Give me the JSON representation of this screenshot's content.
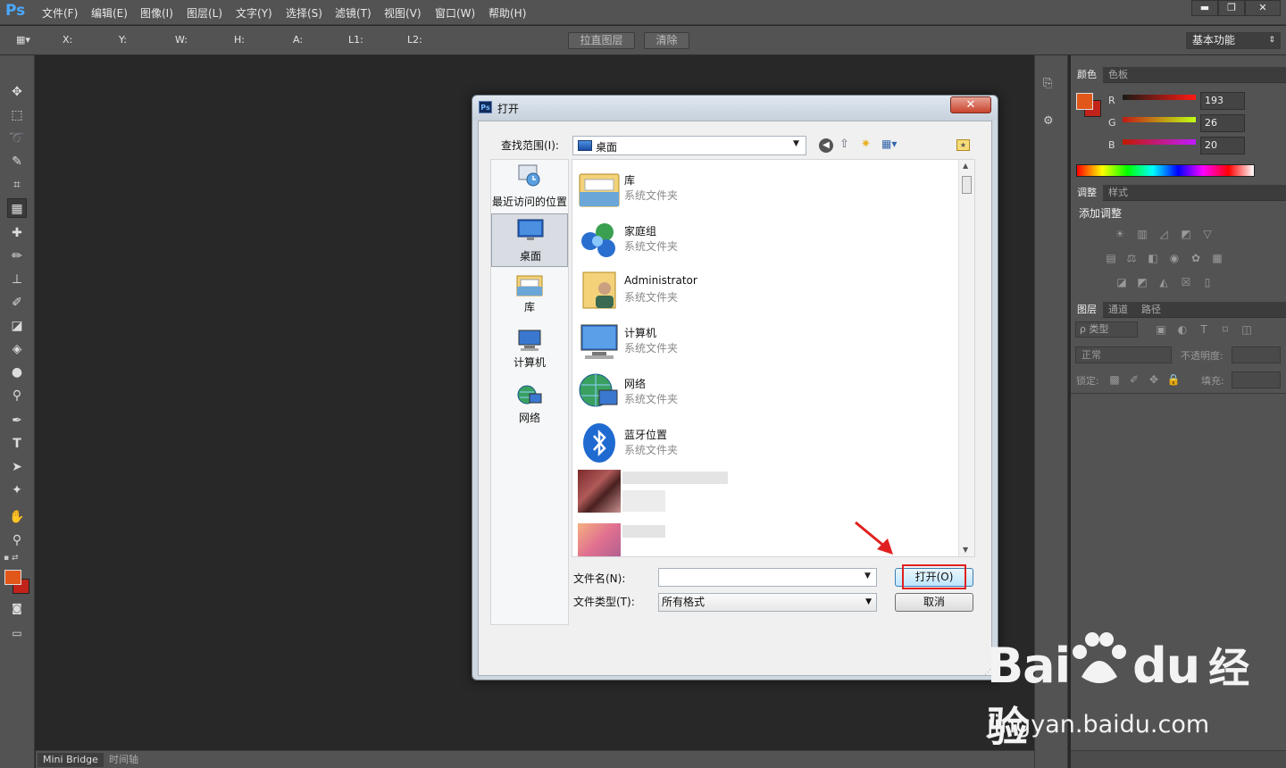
{
  "app": {
    "logo": "Ps",
    "accent": "#4aa8ff"
  },
  "menu": [
    "文件(F)",
    "编辑(E)",
    "图像(I)",
    "图层(L)",
    "文字(Y)",
    "选择(S)",
    "滤镜(T)",
    "视图(V)",
    "窗口(W)",
    "帮助(H)"
  ],
  "window_controls": {
    "minimize": "▬",
    "restore": "❐",
    "close": "✕"
  },
  "options": {
    "labels": [
      "X:",
      "Y:",
      "W:",
      "H:",
      "A:",
      "L1:",
      "L2:"
    ],
    "straighten_button": "拉直图层",
    "clear_button": "清除",
    "workspace": "基本功能"
  },
  "panels": {
    "color": {
      "tabs": [
        "颜色",
        "色板"
      ],
      "r_label": "R",
      "g_label": "G",
      "b_label": "B",
      "r": "193",
      "g": "26",
      "b": "20",
      "foreground": "#e1571a",
      "background": "#c1231a"
    },
    "adjust": {
      "tabs": [
        "调整",
        "样式"
      ],
      "title": "添加调整"
    },
    "layers": {
      "tabs": [
        "图层",
        "通道",
        "路径"
      ],
      "kind_label": "ρ 类型",
      "blend_mode": "正常",
      "opacity_label": "不透明度:",
      "lock_label": "锁定:",
      "fill_label": "填充:"
    }
  },
  "bottom_tabs": [
    "Mini Bridge",
    "时间轴"
  ],
  "dialog": {
    "title": "打开",
    "look_in_label": "查找范围(I):",
    "look_in_value": "桌面",
    "places": [
      {
        "label": "最近访问的位置",
        "icon": "recent-places-icon"
      },
      {
        "label": "桌面",
        "icon": "desktop-icon"
      },
      {
        "label": "库",
        "icon": "library-icon"
      },
      {
        "label": "计算机",
        "icon": "computer-icon"
      },
      {
        "label": "网络",
        "icon": "network-icon"
      }
    ],
    "files": [
      {
        "name": "库",
        "type": "系统文件夹",
        "icon": "library-folder-icon"
      },
      {
        "name": "家庭组",
        "type": "系统文件夹",
        "icon": "homegroup-icon"
      },
      {
        "name": "Administrator",
        "type": "系统文件夹",
        "icon": "user-folder-icon"
      },
      {
        "name": "计算机",
        "type": "系统文件夹",
        "icon": "computer-icon"
      },
      {
        "name": "网络",
        "type": "系统文件夹",
        "icon": "network-icon"
      },
      {
        "name": "蓝牙位置",
        "type": "系统文件夹",
        "icon": "bluetooth-icon"
      }
    ],
    "filename_label": "文件名(N):",
    "filename_value": "",
    "filetype_label": "文件类型(T):",
    "filetype_value": "所有格式",
    "open_button": "打开(O)",
    "cancel_button": "取消",
    "highlight_color": "#e02020"
  },
  "watermark": {
    "brand": "Bai",
    "brand2": "du",
    "product": "经验",
    "url": "jingyan.baidu.com"
  }
}
